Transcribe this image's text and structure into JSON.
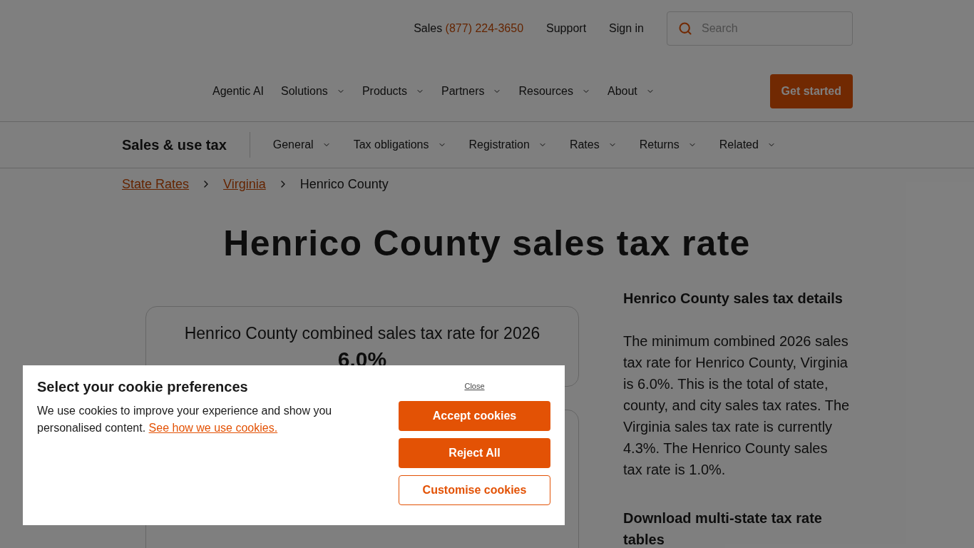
{
  "utility_nav": {
    "sales_label": "Sales",
    "sales_phone": "(877) 224-3650",
    "links": [
      "Support",
      "Sign in"
    ],
    "search": {
      "placeholder": "Search"
    }
  },
  "main_nav": {
    "items": [
      {
        "label": "Agentic AI",
        "has_menu": false
      },
      {
        "label": "Solutions",
        "has_menu": true
      },
      {
        "label": "Products",
        "has_menu": true
      },
      {
        "label": "Partners",
        "has_menu": true
      },
      {
        "label": "Resources",
        "has_menu": true
      },
      {
        "label": "About",
        "has_menu": true
      }
    ],
    "cta": "Get started"
  },
  "sub_nav": {
    "title": "Sales & use tax",
    "items": [
      "General",
      "Tax obligations",
      "Registration",
      "Rates",
      "Returns",
      "Related"
    ]
  },
  "breadcrumbs": [
    {
      "label": "State Rates",
      "link": true
    },
    {
      "label": "Virginia",
      "link": true
    },
    {
      "label": "Henrico County",
      "link": false
    }
  ],
  "heading": "Henrico County sales tax rate",
  "rate_card": {
    "title": "Henrico County combined sales tax rate for 2026",
    "rate": "6.0%"
  },
  "sidebar": {
    "details_title": "Henrico County sales tax details",
    "details_text": "The minimum combined 2026 sales tax rate for Henrico County, Virginia is 6.0%. This is the total of state, county, and city sales tax rates. The Virginia sales tax rate is currently 4.3%. The Henrico County sales tax rate is 1.0%.",
    "download_title": "Download multi-state tax rate tables"
  },
  "cookie_dialog": {
    "title": "Select your cookie preferences",
    "text": "We use cookies to improve your experience and show you personalised content.",
    "link": "See how we use cookies.",
    "close": "Close",
    "buttons": [
      {
        "label": "Accept cookies",
        "kind": "primary"
      },
      {
        "label": "Reject All",
        "kind": "primary"
      },
      {
        "label": "Customise cookies",
        "kind": "outline"
      }
    ]
  }
}
